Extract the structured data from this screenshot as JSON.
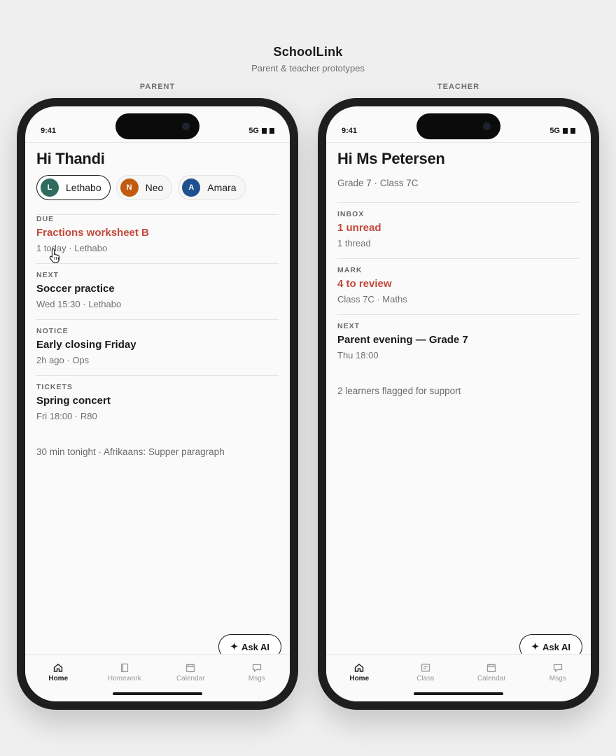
{
  "header": {
    "title": "SchoolLink",
    "subtitle": "Parent & teacher prototypes"
  },
  "colors": {
    "urgent": "#c2483b",
    "avatar_lethabo": "#2f6b5e",
    "avatar_neo": "#c25a12",
    "avatar_amara": "#1f4f8f"
  },
  "parent": {
    "label": "PARENT",
    "status": {
      "time": "9:41",
      "network": "5G"
    },
    "greeting": "Hi Thandi",
    "children": [
      {
        "initial": "L",
        "name": "Lethabo"
      },
      {
        "initial": "N",
        "name": "Neo"
      },
      {
        "initial": "A",
        "name": "Amara"
      }
    ],
    "cards": [
      {
        "label": "DUE",
        "title": "Fractions worksheet B",
        "sub": "1 today · Lethabo"
      },
      {
        "label": "NEXT",
        "title": "Soccer practice",
        "sub": "Wed 15:30 · Lethabo"
      },
      {
        "label": "NOTICE",
        "title": "Early closing Friday",
        "sub": "2h ago · Ops"
      },
      {
        "label": "TICKETS",
        "title": "Spring concert",
        "sub": "Fri 18:00 · R80"
      }
    ],
    "tip": "30 min tonight · Afrikaans: Supper paragraph",
    "ask_ai": "Ask AI",
    "tabs": [
      {
        "label": "Home",
        "icon": "home-icon"
      },
      {
        "label": "Homework",
        "icon": "book-icon"
      },
      {
        "label": "Calendar",
        "icon": "calendar-icon"
      },
      {
        "label": "Msgs",
        "icon": "chat-icon"
      }
    ]
  },
  "teacher": {
    "label": "TEACHER",
    "status": {
      "time": "9:41",
      "network": "5G"
    },
    "greeting": "Hi Ms Petersen",
    "subline": "Grade 7 · Class 7C",
    "cards": [
      {
        "label": "INBOX",
        "title": "1 unread",
        "sub": "1 thread"
      },
      {
        "label": "MARK",
        "title": "4 to review",
        "sub": "Class 7C · Maths"
      },
      {
        "label": "NEXT",
        "title": "Parent evening — Grade 7",
        "sub": "Thu 18:00"
      }
    ],
    "tip": "2 learners flagged for support",
    "ask_ai": "Ask AI",
    "tabs": [
      {
        "label": "Home",
        "icon": "home-icon"
      },
      {
        "label": "Class",
        "icon": "class-icon"
      },
      {
        "label": "Calendar",
        "icon": "calendar-icon"
      },
      {
        "label": "Msgs",
        "icon": "chat-icon"
      }
    ]
  }
}
